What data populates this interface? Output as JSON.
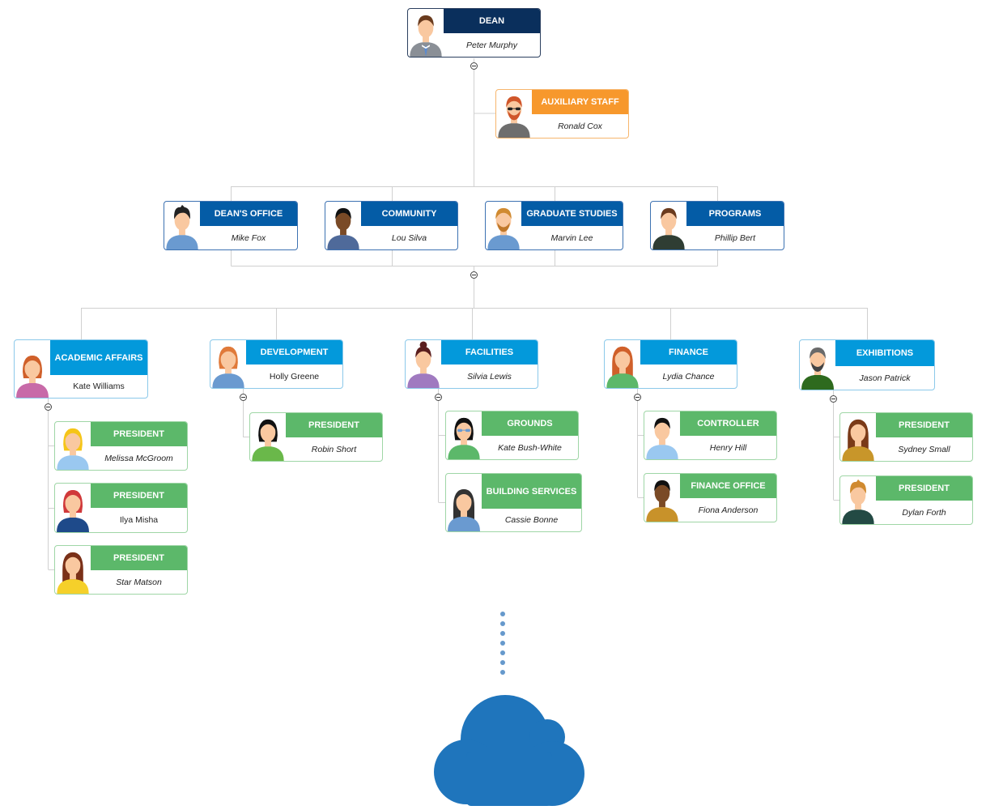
{
  "diagram": {
    "type": "org-chart",
    "colors": {
      "dean": "#0a2f5c",
      "auxiliary": "#f7982c",
      "level2": "#045ca6",
      "level3": "#0399db",
      "level4": "#5cb86a",
      "connector": "#d0d0d0",
      "cloud": "#1f75bc"
    },
    "root": {
      "title": "DEAN",
      "name": "Peter Murphy"
    },
    "auxiliary": {
      "title": "AUXILIARY STAFF",
      "name": "Ronald Cox"
    },
    "level2": [
      {
        "title": "DEAN'S OFFICE",
        "name": "Mike Fox"
      },
      {
        "title": "COMMUNITY",
        "name": "Lou Silva"
      },
      {
        "title": "GRADUATE STUDIES",
        "name": "Marvin Lee"
      },
      {
        "title": "PROGRAMS",
        "name": "Phillip Bert"
      }
    ],
    "departments": [
      {
        "title": "ACADEMIC AFFAIRS",
        "name": "Kate Williams",
        "children": [
          {
            "title": "PRESIDENT",
            "name": "Melissa McGroom"
          },
          {
            "title": "PRESIDENT",
            "name": "Ilya Misha"
          },
          {
            "title": "PRESIDENT",
            "name": "Star Matson"
          }
        ]
      },
      {
        "title": "DEVELOPMENT",
        "name": "Holly Greene",
        "children": [
          {
            "title": "PRESIDENT",
            "name": "Robin Short"
          }
        ]
      },
      {
        "title": "FACILITIES",
        "name": "Silvia Lewis",
        "children": [
          {
            "title": "GROUNDS",
            "name": "Kate Bush-White"
          },
          {
            "title": "BUILDING SERVICES",
            "name": "Cassie Bonne"
          }
        ]
      },
      {
        "title": "FINANCE",
        "name": "Lydia Chance",
        "children": [
          {
            "title": "CONTROLLER",
            "name": "Henry Hill"
          },
          {
            "title": "FINANCE OFFICE",
            "name": "Fiona Anderson"
          }
        ]
      },
      {
        "title": "EXHIBITIONS",
        "name": "Jason Patrick",
        "children": [
          {
            "title": "PRESIDENT",
            "name": "Sydney Small"
          },
          {
            "title": "PRESIDENT",
            "name": "Dylan Forth"
          }
        ]
      }
    ],
    "footer_icon": "cloud-icon"
  }
}
